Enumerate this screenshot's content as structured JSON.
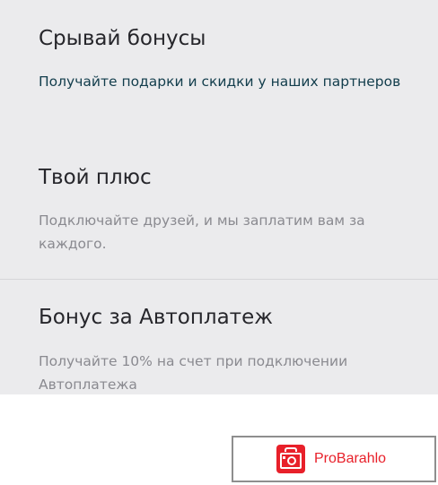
{
  "bonus_cards": [
    {
      "title": "Срывай бонусы",
      "description": "Получайте подарки и скидки у наших партнеров",
      "state": "active"
    },
    {
      "title": "Твой плюс",
      "description": "Подключайте друзей, и мы заплатим вам за каждого.",
      "state": "muted"
    },
    {
      "title": "Бонус за Автоплатеж",
      "description": "Получайте 10% на счет при подключении Автоплатежа",
      "state": "muted"
    }
  ],
  "watermark": {
    "text": "ProBarahlo",
    "icon": "camera-icon",
    "color": "#e8202a"
  },
  "colors": {
    "panel_background": "#ebebed",
    "title_text": "#26262b",
    "active_description": "#123d4c",
    "muted_description": "#8a8a90"
  }
}
